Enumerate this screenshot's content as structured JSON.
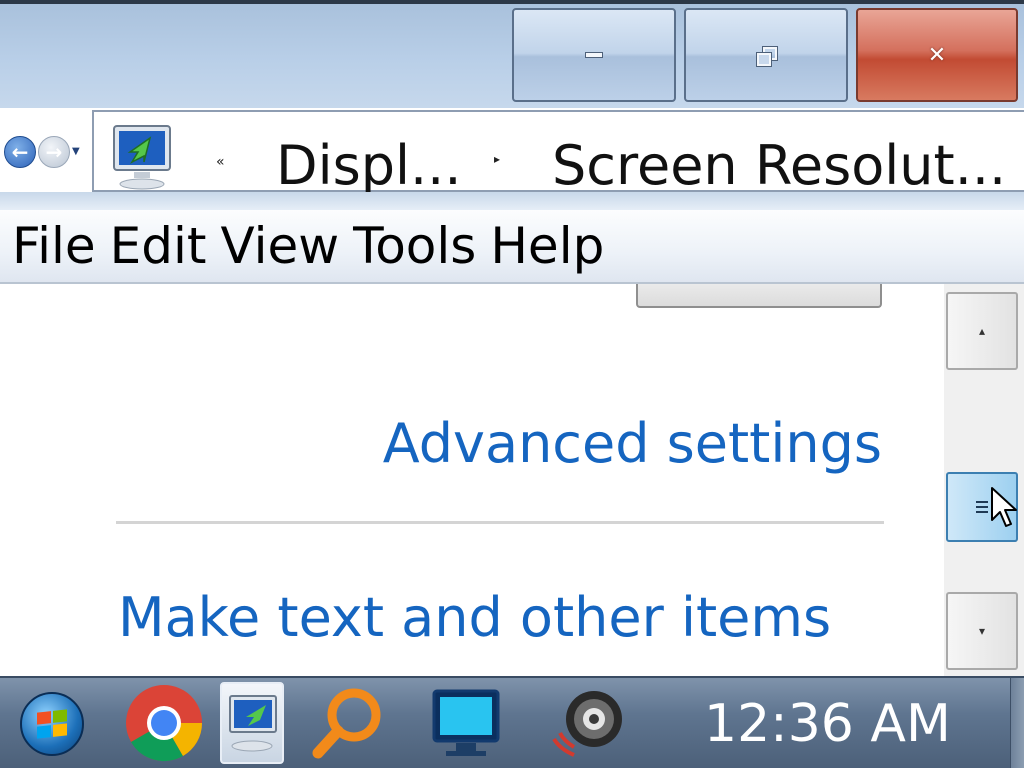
{
  "window": {
    "minimize_label": "Minimize",
    "maximize_label": "Restore Down",
    "close_label": "Close"
  },
  "address": {
    "chevron_left": "«",
    "crumbs": [
      "Displ...",
      "Screen Resolut..."
    ],
    "separator": "▸"
  },
  "menu": {
    "items": [
      "File",
      "Edit",
      "View",
      "Tools",
      "Help"
    ]
  },
  "content": {
    "advanced_link": "Advanced settings",
    "text_link": "Make text and other items"
  },
  "taskbar": {
    "clock": "12:36 AM",
    "apps": [
      "windows-start",
      "chrome",
      "control-panel-display",
      "search",
      "display-monitor",
      "speaker"
    ]
  },
  "colors": {
    "link": "#1565c0",
    "titlebar": "#b9cfe8",
    "close_button": "#c24b33",
    "taskbar": "#5f7590"
  }
}
